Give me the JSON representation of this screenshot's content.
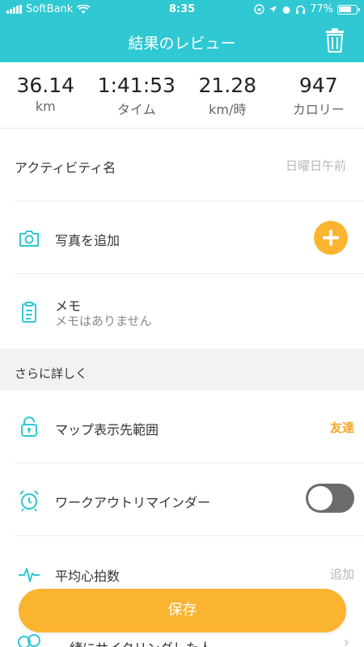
{
  "status_bar": {
    "carrier": "SoftBank",
    "time": "8:35",
    "battery": "77%",
    "battery_level": 0.77
  },
  "header": {
    "title": "結果のレビュー",
    "trash_icon": "trash-icon"
  },
  "stats": [
    {
      "value": "36.14",
      "unit": "km"
    },
    {
      "value": "1:41:53",
      "unit": "タイム"
    },
    {
      "value": "21.28",
      "unit": "km/時"
    },
    {
      "value": "947",
      "unit": "カロリー"
    }
  ],
  "activity_name": {
    "label": "アクティビティ名",
    "placeholder": "日曜日午前"
  },
  "photo": {
    "label": "写真を追加",
    "icon": "camera-icon"
  },
  "memo": {
    "label": "メモ",
    "placeholder": "メモはありません",
    "icon": "clipboard-icon"
  },
  "details_section": {
    "title": "さらに詳しく"
  },
  "map_visibility": {
    "label": "マップ表示先範囲",
    "value": "友達",
    "icon": "lock-icon"
  },
  "workout_reminder": {
    "label": "ワークアウトリマインダー",
    "enabled": false,
    "icon": "alarm-clock-icon"
  },
  "heart_rate": {
    "label": "平均心拍数",
    "value": "追加",
    "icon": "heartbeat-icon"
  },
  "riding_with": {
    "label": "一緒にサイクリングした人"
  },
  "save_button": {
    "label": "保存"
  },
  "colors": {
    "accent": "#2fc8d3",
    "orange": "#fbb430",
    "toggle_off": "#6b6b6b"
  }
}
